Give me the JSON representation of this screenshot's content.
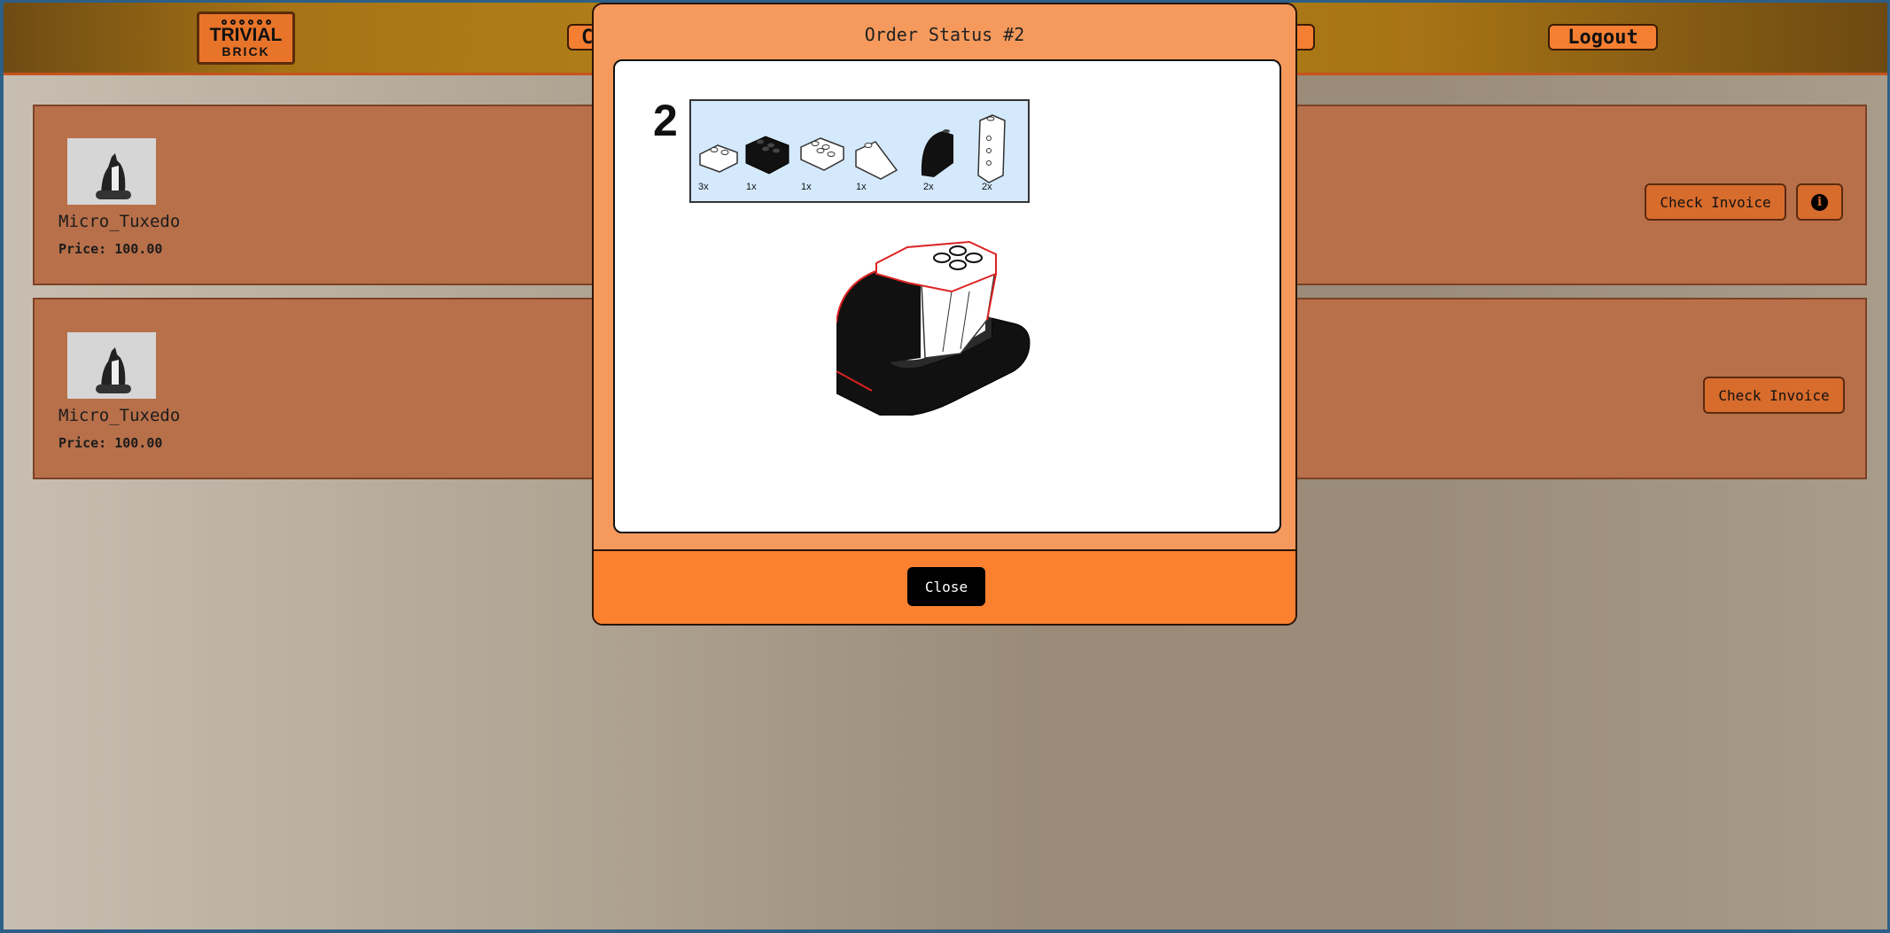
{
  "header": {
    "logo": {
      "line1": "TRIVIAL",
      "line2": "BRICK"
    },
    "nav_partial_left": "C",
    "logout_label": "Logout"
  },
  "orders": [
    {
      "name": "Micro_Tuxedo",
      "price": "Price: 100.00",
      "invoice_label": "Check Invoice",
      "has_info": true
    },
    {
      "name": "Micro_Tuxedo",
      "price": "Price: 100.00",
      "invoice_label": "Check Invoice",
      "has_info": false
    }
  ],
  "modal": {
    "title": "Order Status #2",
    "step_number": "2",
    "parts": [
      {
        "qty": "3x",
        "brick": "white-2x2-plate"
      },
      {
        "qty": "1x",
        "brick": "black-2x2-brick"
      },
      {
        "qty": "1x",
        "brick": "white-2x2-plate"
      },
      {
        "qty": "1x",
        "brick": "white-slope"
      },
      {
        "qty": "2x",
        "brick": "black-curved-slope"
      },
      {
        "qty": "2x",
        "brick": "white-1x1-tall"
      }
    ],
    "close_label": "Close"
  },
  "colors": {
    "accent": "#f47f32",
    "card": "#b8704a",
    "modal": "#f59a5c",
    "modal_footer": "#fb8131"
  }
}
